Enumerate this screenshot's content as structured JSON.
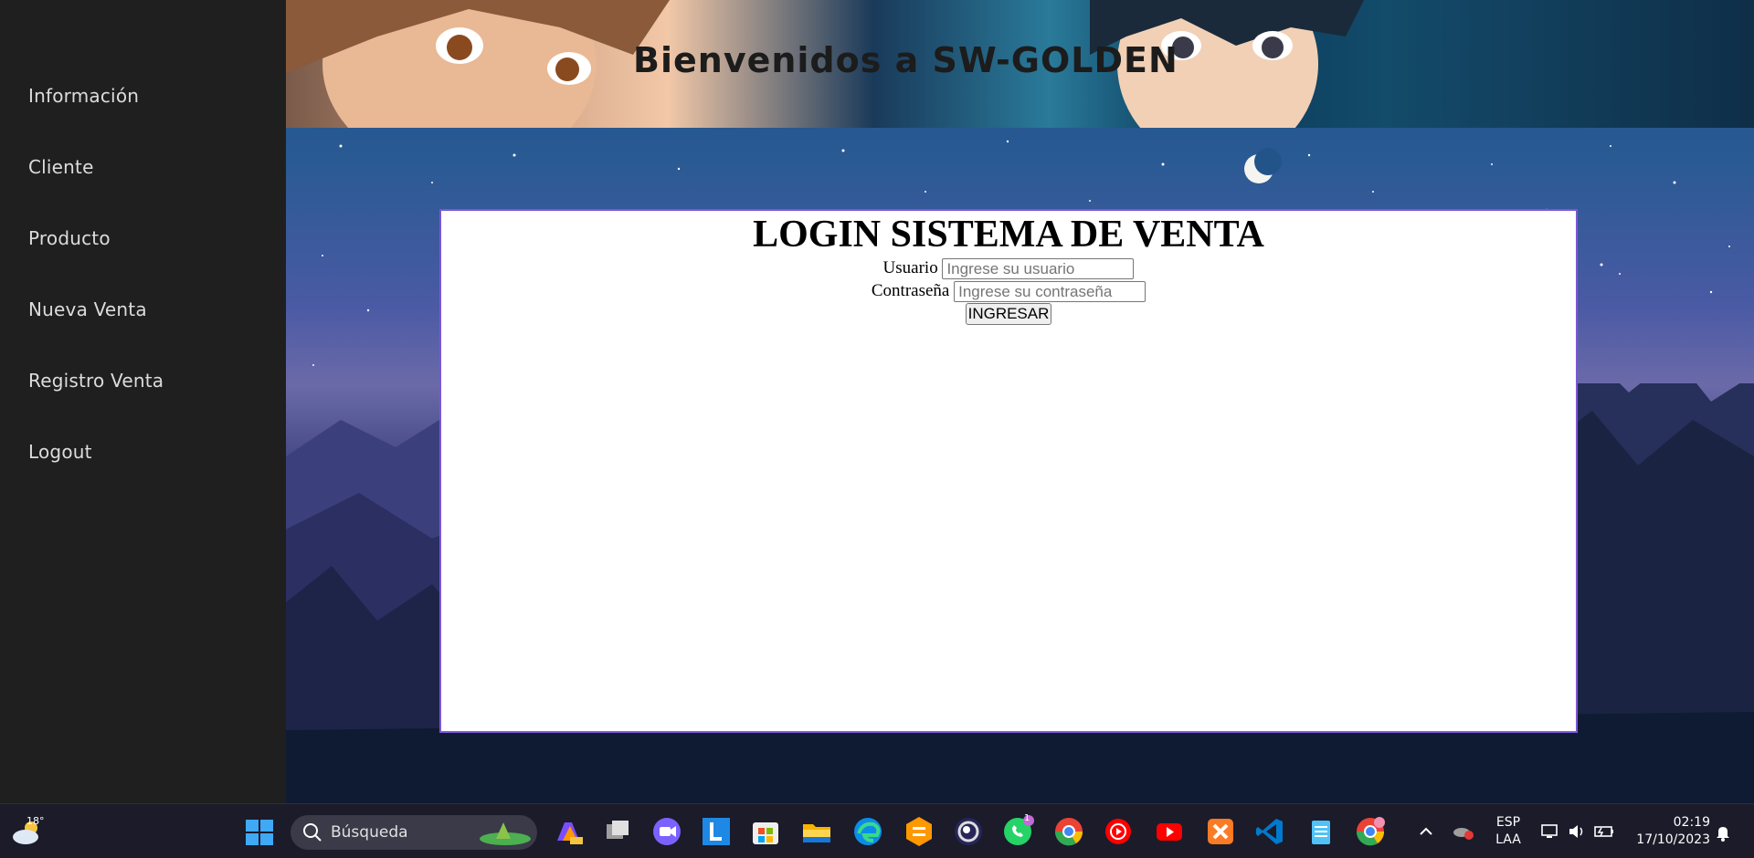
{
  "sidebar": {
    "items": [
      {
        "label": "Información"
      },
      {
        "label": "Cliente"
      },
      {
        "label": "Producto"
      },
      {
        "label": "Nueva Venta"
      },
      {
        "label": "Registro Venta"
      },
      {
        "label": "Logout"
      }
    ]
  },
  "banner": {
    "title": "Bienvenidos a SW-GOLDEN"
  },
  "login": {
    "title": "LOGIN SISTEMA DE VENTA",
    "username_label": "Usuario",
    "username_placeholder": "Ingrese su usuario",
    "password_label": "Contraseña",
    "password_placeholder": "Ingrese su contraseña",
    "submit_label": "INGRESAR"
  },
  "taskbar": {
    "weather_temp": "18°",
    "search_placeholder": "Búsqueda",
    "whatsapp_badge": "1",
    "apps": [
      "copilot-icon",
      "task-view-icon",
      "video-call-icon",
      "l-app-icon",
      "store-icon",
      "file-explorer-icon",
      "edge-icon",
      "sublime-icon",
      "cinema4d-icon",
      "whatsapp-icon",
      "chrome-icon",
      "youtube-music-icon",
      "youtube-icon",
      "xampp-icon",
      "vscode-icon",
      "notepad-icon",
      "chrome-profile-icon"
    ],
    "language": "ESP",
    "keyboard": "LAA",
    "time": "02:19",
    "date": "17/10/2023"
  },
  "colors": {
    "sidebar_bg": "#1f1f1f",
    "panel_border": "#7b57d6",
    "taskbar_bg": "#1b1b2a"
  }
}
